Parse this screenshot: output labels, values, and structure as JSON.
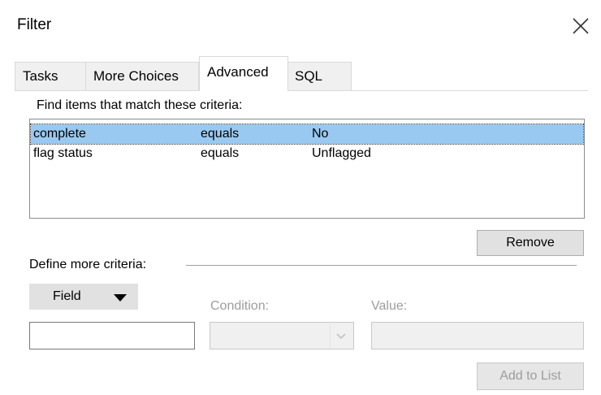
{
  "dialog": {
    "title": "Filter"
  },
  "tabs": [
    {
      "label": "Tasks",
      "active": false
    },
    {
      "label": "More Choices",
      "active": false
    },
    {
      "label": "Advanced",
      "active": true
    },
    {
      "label": "SQL",
      "active": false
    }
  ],
  "criteria": {
    "label": "Find items that match these criteria:",
    "rows": [
      {
        "field": "complete",
        "condition": "equals",
        "value": "No",
        "selected": true
      },
      {
        "field": "flag status",
        "condition": "equals",
        "value": "Unflagged",
        "selected": false
      }
    ]
  },
  "buttons": {
    "remove": "Remove",
    "field": "Field",
    "add_to_list": "Add to List"
  },
  "define": {
    "label": "Define more criteria:",
    "condition_label": "Condition:",
    "value_label": "Value:",
    "field_value": "",
    "value_value": ""
  },
  "icons": {
    "close": "close-icon",
    "field_arrow": "triangle-down-icon",
    "combo_arrow": "chevron-down-icon"
  },
  "colors": {
    "selection": "#99c9f0",
    "button_face": "#e1e1e1",
    "disabled_text": "#9d9d9d"
  }
}
